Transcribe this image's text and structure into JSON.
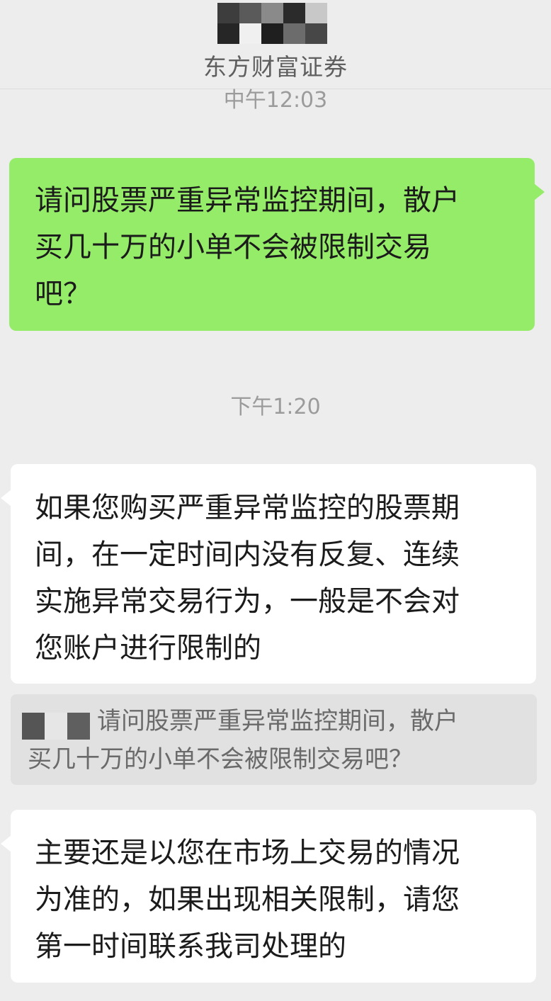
{
  "header": {
    "contact_name": "东方财富证券",
    "avatar_mask": "pixelated-avatar"
  },
  "messages": [
    {
      "type": "timestamp",
      "text": "中午12:03"
    },
    {
      "type": "sent",
      "lines": [
        "请问股票严重异常监控期间，散户",
        "买几十万的小单不会被限制交易",
        "吧？"
      ]
    },
    {
      "type": "timestamp",
      "text": "下午1:20"
    },
    {
      "type": "received",
      "lines": [
        "如果您购买严重异常监控的股票期",
        "间，在一定时间内没有反复、连续",
        "实施异常交易行为，一般是不会对",
        "您账户进行限制的"
      ]
    },
    {
      "type": "quote",
      "lines": [
        "请问股票严重异常监控期间，散户",
        "买几十万的小单不会被限制交易吧？"
      ]
    },
    {
      "type": "received",
      "lines": [
        "主要还是以您在市场上交易的情况",
        "为准的，如果出现相关限制，请您",
        "第一时间联系我司处理的"
      ]
    }
  ],
  "colors": {
    "background": "#ededed",
    "sent_bubble": "#95ec69",
    "received_bubble": "#ffffff",
    "quote_bg": "#e1e1e1",
    "timestamp_text": "#9b9b9b"
  }
}
